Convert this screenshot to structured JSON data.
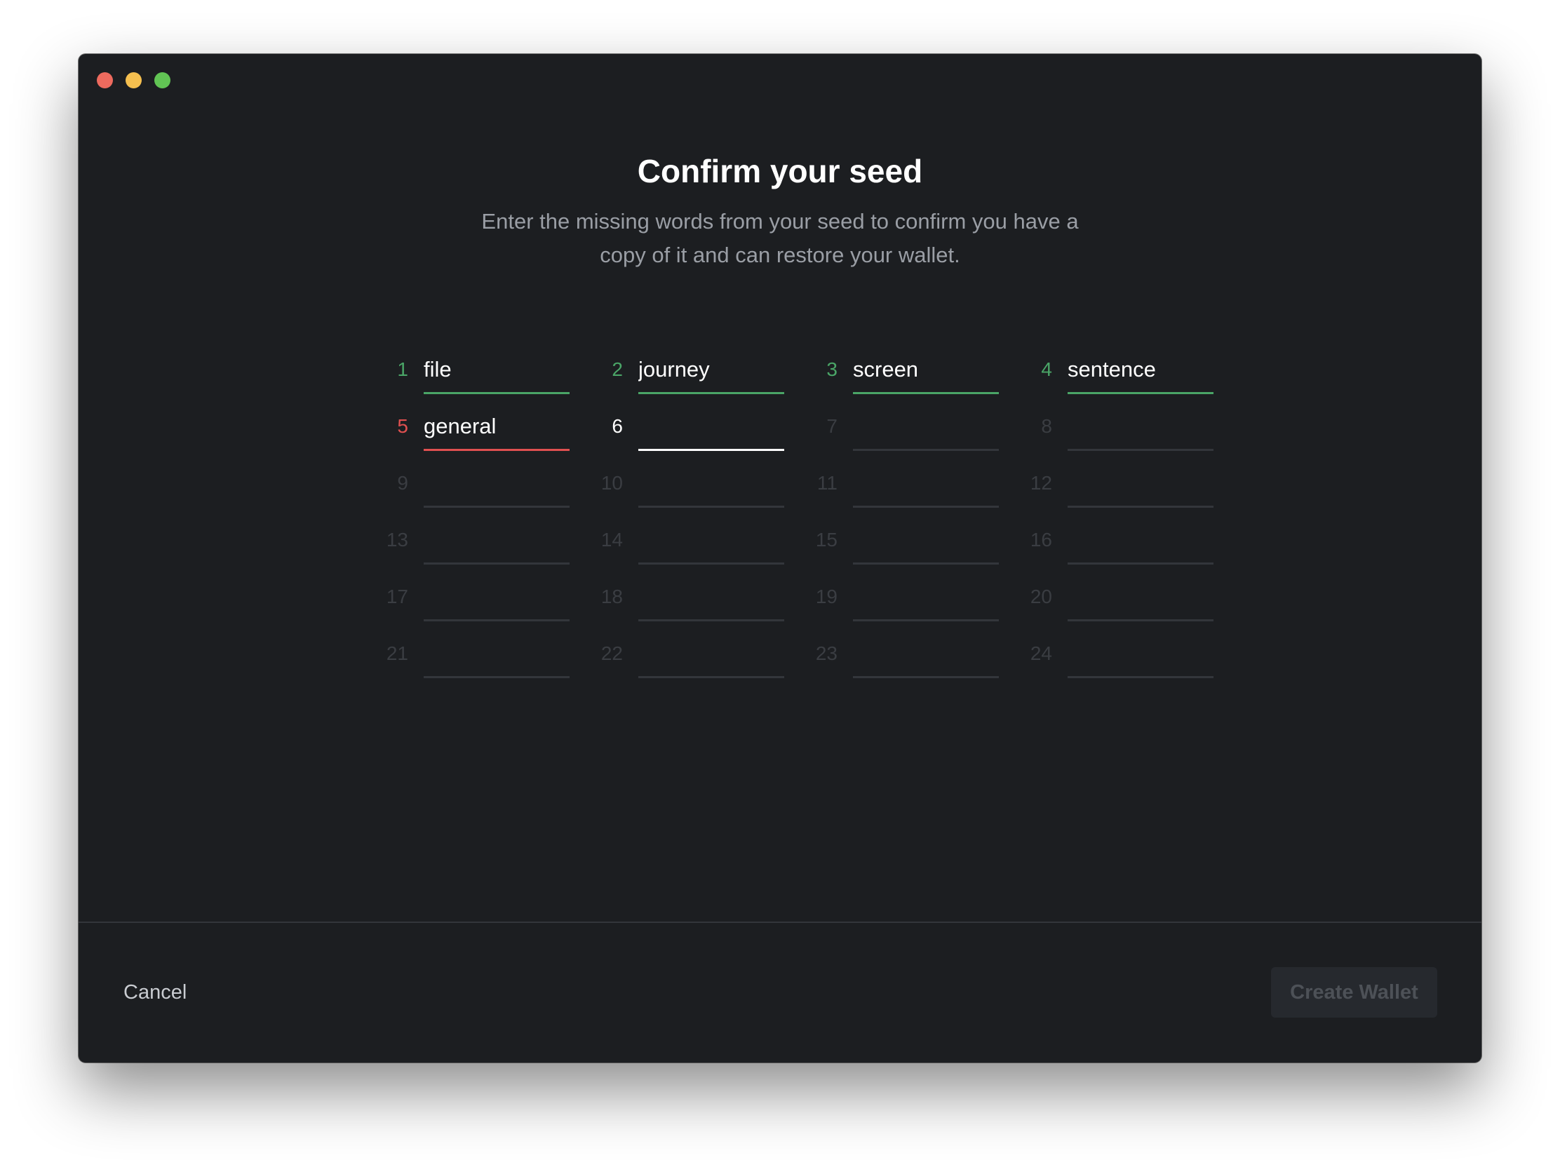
{
  "window": {
    "controls": [
      "close",
      "minimize",
      "maximize"
    ]
  },
  "heading": {
    "title": "Confirm your seed",
    "subtitle_line1": "Enter the missing words from your seed to confirm you have a",
    "subtitle_line2": "copy of it and can restore your wallet."
  },
  "seed_words": [
    {
      "index": "1",
      "word": "file",
      "state": "ok"
    },
    {
      "index": "2",
      "word": "journey",
      "state": "ok"
    },
    {
      "index": "3",
      "word": "screen",
      "state": "ok"
    },
    {
      "index": "4",
      "word": "sentence",
      "state": "ok"
    },
    {
      "index": "5",
      "word": "general",
      "state": "error"
    },
    {
      "index": "6",
      "word": "",
      "state": "active"
    },
    {
      "index": "7",
      "word": "",
      "state": "empty"
    },
    {
      "index": "8",
      "word": "",
      "state": "empty"
    },
    {
      "index": "9",
      "word": "",
      "state": "empty"
    },
    {
      "index": "10",
      "word": "",
      "state": "empty"
    },
    {
      "index": "11",
      "word": "",
      "state": "empty"
    },
    {
      "index": "12",
      "word": "",
      "state": "empty"
    },
    {
      "index": "13",
      "word": "",
      "state": "empty"
    },
    {
      "index": "14",
      "word": "",
      "state": "empty"
    },
    {
      "index": "15",
      "word": "",
      "state": "empty"
    },
    {
      "index": "16",
      "word": "",
      "state": "empty"
    },
    {
      "index": "17",
      "word": "",
      "state": "empty"
    },
    {
      "index": "18",
      "word": "",
      "state": "empty"
    },
    {
      "index": "19",
      "word": "",
      "state": "empty"
    },
    {
      "index": "20",
      "word": "",
      "state": "empty"
    },
    {
      "index": "21",
      "word": "",
      "state": "empty"
    },
    {
      "index": "22",
      "word": "",
      "state": "empty"
    },
    {
      "index": "23",
      "word": "",
      "state": "empty"
    },
    {
      "index": "24",
      "word": "",
      "state": "empty"
    }
  ],
  "colors": {
    "background": "#1c1e21",
    "ok": "#4aa567",
    "error": "#e05050",
    "active": "#ffffff",
    "empty": "#33363b"
  },
  "footer": {
    "cancel_label": "Cancel",
    "create_label": "Create Wallet",
    "create_enabled": false
  }
}
